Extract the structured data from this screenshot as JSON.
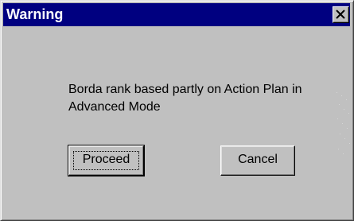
{
  "window": {
    "title": "Warning",
    "close_icon": "close-icon"
  },
  "dialog": {
    "message": "Borda rank based partly on Action Plan in Advanced Mode"
  },
  "buttons": {
    "proceed_label": "Proceed",
    "cancel_label": "Cancel"
  },
  "colors": {
    "titlebar": "#000080",
    "face": "#c0c0c0"
  }
}
